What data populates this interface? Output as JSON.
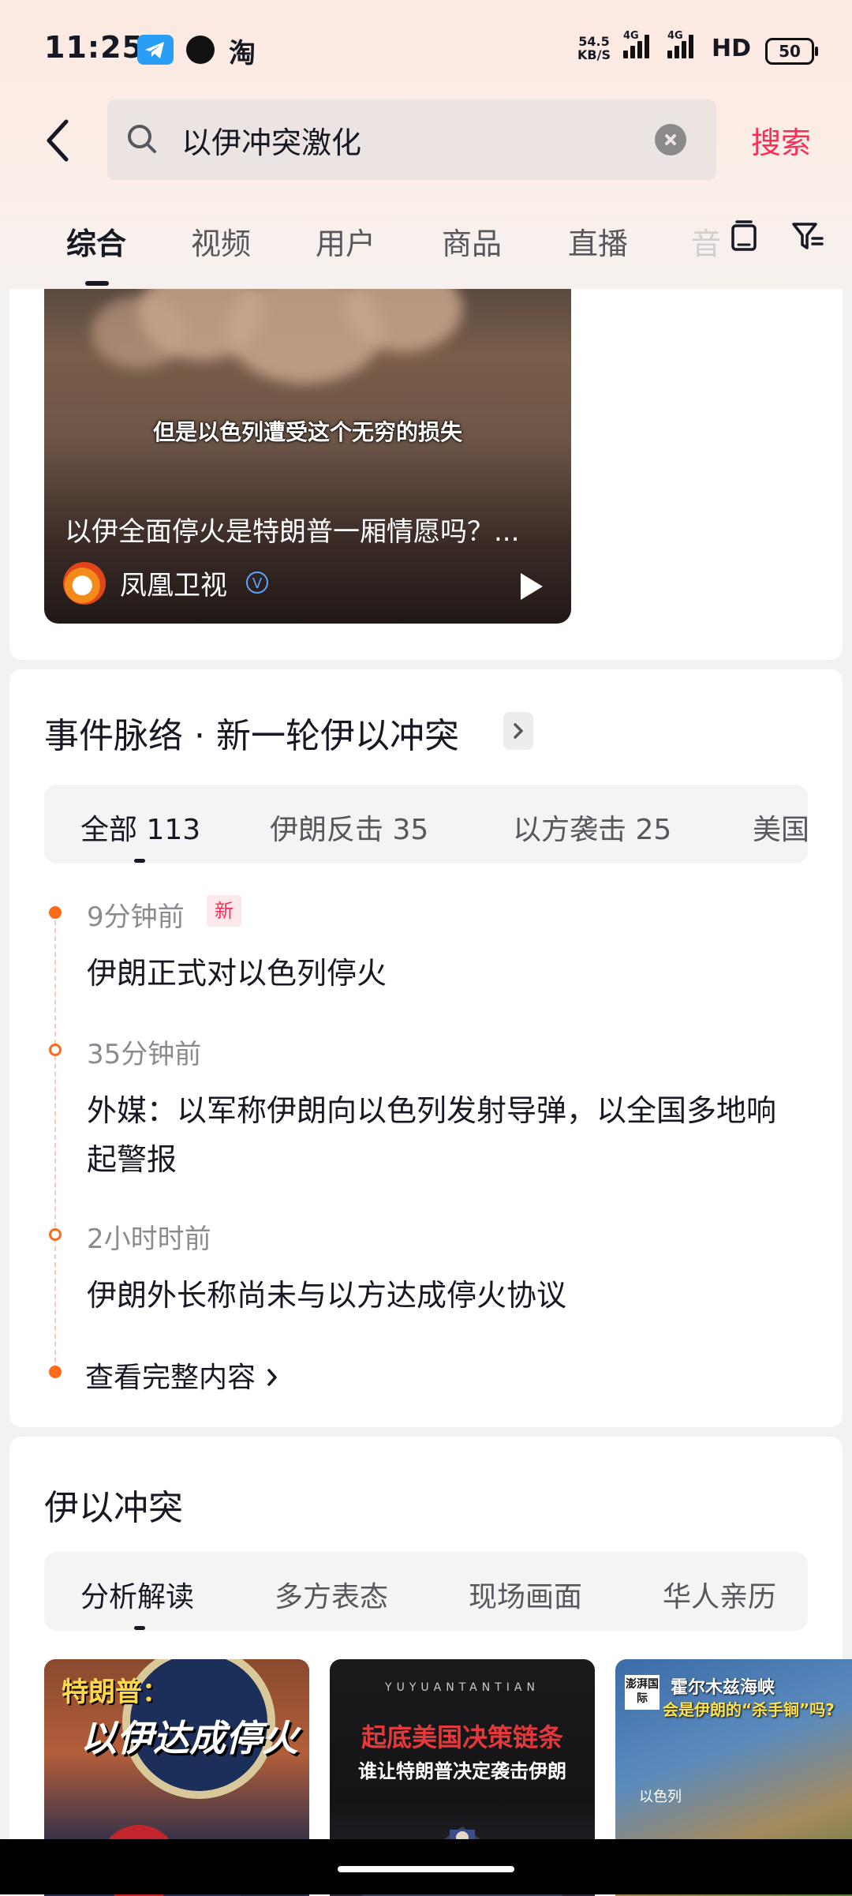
{
  "status_bar": {
    "time": "11:25",
    "net_speed_value": "54.5",
    "net_speed_unit": "KB/S",
    "signal_1_label": "4G",
    "signal_2_label": "4G",
    "hd": "HD",
    "battery": "50",
    "app_icons": [
      "telegram-icon",
      "chat-bubble-icon",
      "taobao-icon"
    ],
    "taobao_label": "淘"
  },
  "search": {
    "query": "以伊冲突激化",
    "submit_label": "搜索"
  },
  "tabs": {
    "items": [
      "综合",
      "视频",
      "用户",
      "商品",
      "直播"
    ],
    "overflow": "音",
    "active": "综合"
  },
  "video_card": {
    "subtitle_caption": "但是以色列遭受这个无穷的损失",
    "title": "以伊全面停火是特朗普一厢情愿吗？...",
    "author": "凤凰卫视"
  },
  "timeline_section": {
    "title": "事件脉络 · 新一轮伊以冲突",
    "chips": [
      {
        "label": "全部 113"
      },
      {
        "label": "伊朗反击 35"
      },
      {
        "label": "以方袭击 25"
      },
      {
        "label": "美国"
      }
    ],
    "events": [
      {
        "time": "9分钟前",
        "badge": "新",
        "text": "伊朗正式对以色列停火"
      },
      {
        "time": "35分钟前",
        "text": "外媒：以军称伊朗向以色列发射导弹，以全国多地响起警报"
      },
      {
        "time": "2小时时前",
        "text": "伊朗外长称尚未与以方达成停火协议"
      }
    ],
    "view_more": "查看完整内容"
  },
  "topic_section": {
    "title": "伊以冲突",
    "chips": [
      "分析解读",
      "多方表态",
      "现场画面",
      "华人亲历"
    ],
    "thumbnails": [
      {
        "line1": "特朗普：",
        "line2": "以伊达成停火"
      },
      {
        "top": "YUYUANTANTIAN",
        "line1": "起底美国决策链条",
        "line2": "谁让特朗普决定袭击伊朗"
      },
      {
        "logo": "澎湃国际",
        "line1": "霍尔木兹海峡",
        "line2": "会是伊朗的“杀手锏”吗?",
        "map_label": "以色列"
      }
    ]
  },
  "colors": {
    "accent": "#fe2c55",
    "timeline": "#fe6a1a"
  }
}
